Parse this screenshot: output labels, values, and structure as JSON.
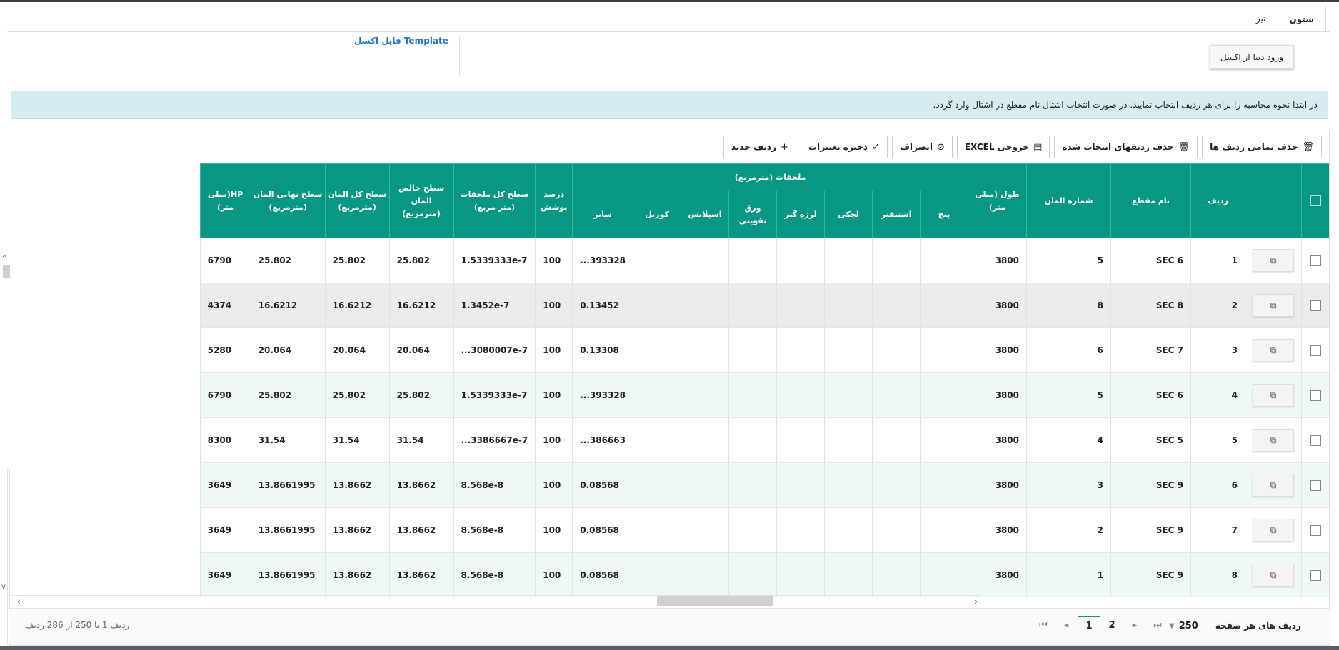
{
  "tabs": [
    {
      "label": "ستون",
      "active": true
    },
    {
      "label": "تیر",
      "active": false
    }
  ],
  "import": {
    "button_label": "ورود دیتا از اکسل",
    "template_link": "Template فایل اکسل"
  },
  "alert": {
    "text": "در ابتدا نحوه محاسبه را برای هر ردیف انتخاب نمایید. در صورت انتخاب اشتال نام مقطع در اشتال وارد گردد."
  },
  "toolbar": {
    "new_row": "ردیف جدید",
    "save_changes": "ذخیره تغییرات",
    "cancel": "انصراف",
    "export_excel": "خروجی EXCEL",
    "delete_selected": "حذف ردیفهای انتخاب شده",
    "delete_all": "حذف تمامی ردیف ها"
  },
  "grid": {
    "columns": {
      "row": "ردیف",
      "section_name": "نام مقطع",
      "element_number": "شماره المان",
      "length": "طول (میلی متر)",
      "attachments_group": "ملحقات (مترمربع)",
      "screw": "پیچ",
      "stiffener": "استیفنر",
      "lachaki": "لچکی",
      "vibration_damper": "لرزه گیر",
      "reinforcing_plate": "ورق تقویتی",
      "splice": "اسپلایس",
      "corbel": "کوربل",
      "other": "سایر",
      "coating_percent": "درصد پوشش",
      "total_attachments_area": "سطح کل ملحقات (متر مربع)",
      "net_element_area": "سطح خالص المان (مترمربع)",
      "total_element_area": "سطح کل المان (مترمربع)",
      "final_element_area": "سطح نهایی المان (مترمربع)",
      "hp": "HP(میلی متر)"
    },
    "rows": [
      {
        "row": "1",
        "section": "SEC 6",
        "element": "5",
        "length": "3800",
        "other": "...393328",
        "coating": "100",
        "total_att": "1.5339333e-7",
        "net": "25.802",
        "total": "25.802",
        "final": "25.802",
        "hp": "6790"
      },
      {
        "row": "2",
        "section": "SEC 8",
        "element": "8",
        "length": "3800",
        "other": "0.13452",
        "coating": "100",
        "total_att": "1.3452e-7",
        "net": "16.6212",
        "total": "16.6212",
        "final": "16.6212",
        "hp": "4374"
      },
      {
        "row": "3",
        "section": "SEC 7",
        "element": "6",
        "length": "3800",
        "other": "0.13308",
        "coating": "100",
        "total_att": "...3080007e-7",
        "net": "20.064",
        "total": "20.064",
        "final": "20.064",
        "hp": "5280"
      },
      {
        "row": "4",
        "section": "SEC 6",
        "element": "5",
        "length": "3800",
        "other": "...393328",
        "coating": "100",
        "total_att": "1.5339333e-7",
        "net": "25.802",
        "total": "25.802",
        "final": "25.802",
        "hp": "6790"
      },
      {
        "row": "5",
        "section": "SEC 5",
        "element": "4",
        "length": "3800",
        "other": "...386663",
        "coating": "100",
        "total_att": "...3386667e-7",
        "net": "31.54",
        "total": "31.54",
        "final": "31.54",
        "hp": "8300"
      },
      {
        "row": "6",
        "section": "SEC 9",
        "element": "3",
        "length": "3800",
        "other": "0.08568",
        "coating": "100",
        "total_att": "8.568e-8",
        "net": "13.8662",
        "total": "13.8662",
        "final": "13.8661995",
        "hp": "3649"
      },
      {
        "row": "7",
        "section": "SEC 9",
        "element": "2",
        "length": "3800",
        "other": "0.08568",
        "coating": "100",
        "total_att": "8.568e-8",
        "net": "13.8662",
        "total": "13.8662",
        "final": "13.8661995",
        "hp": "3649"
      },
      {
        "row": "8",
        "section": "SEC 9",
        "element": "1",
        "length": "3800",
        "other": "0.08568",
        "coating": "100",
        "total_att": "8.568e-8",
        "net": "13.8662",
        "total": "13.8662",
        "final": "13.8661995",
        "hp": "3649"
      }
    ]
  },
  "footer": {
    "range_text": "ردیف 1 تا 250 از 286 ردیف",
    "pages": [
      "1",
      "2"
    ],
    "current_page": "1",
    "page_size": "250",
    "page_size_label": "ردیف های هر صفحه"
  },
  "colors": {
    "header_bg": "#079783",
    "alert_bg": "#d7ecf1",
    "link": "#2277cc",
    "alt_row": "#f0f8f6"
  }
}
